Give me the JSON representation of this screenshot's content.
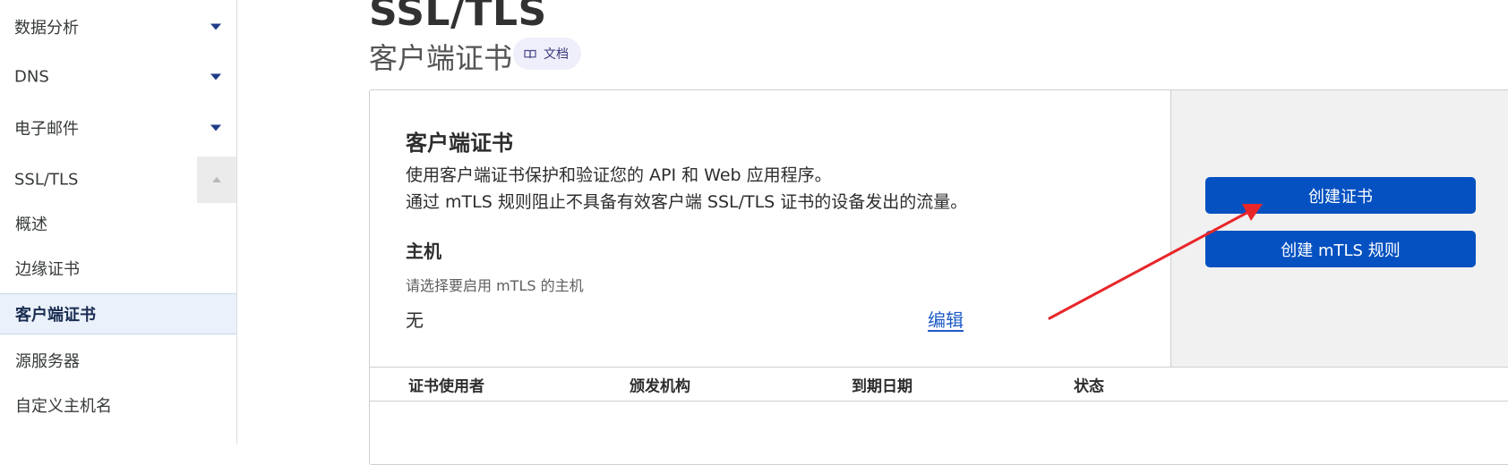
{
  "sidebar": {
    "groups": [
      {
        "label": "数据分析"
      },
      {
        "label": "DNS"
      },
      {
        "label": "电子邮件"
      },
      {
        "label": "SSL/TLS"
      }
    ],
    "items": [
      {
        "label": "概述"
      },
      {
        "label": "边缘证书"
      },
      {
        "label": "客户端证书"
      },
      {
        "label": "源服务器"
      },
      {
        "label": "自定义主机名"
      }
    ],
    "active_item": "客户端证书"
  },
  "header": {
    "title": "SSL/TLS",
    "subtitle": "客户端证书",
    "docs_label": "文档"
  },
  "card": {
    "title": "客户端证书",
    "description_lines": [
      "使用客户端证书保护和验证您的 API 和 Web 应用程序。",
      "通过 mTLS 规则阻止不具备有效客户端 SSL/TLS 证书的设备发出的流量。"
    ],
    "host_heading": "主机",
    "host_hint": "请选择要启用 mTLS 的主机",
    "host_value": "无",
    "edit_label": "编辑",
    "buttons": {
      "create_certificate": "创建证书",
      "create_mtls_rule": "创建 mTLS 规则"
    }
  },
  "table": {
    "columns": [
      "证书使用者",
      "颁发机构",
      "到期日期",
      "状态"
    ]
  },
  "colors": {
    "primary_button": "#0551c1",
    "link": "#1f5bc6",
    "sidebar_caret": "#1f3c88",
    "active_nav_bg": "#eaf1fb",
    "annotation_arrow": "#e8262a"
  }
}
